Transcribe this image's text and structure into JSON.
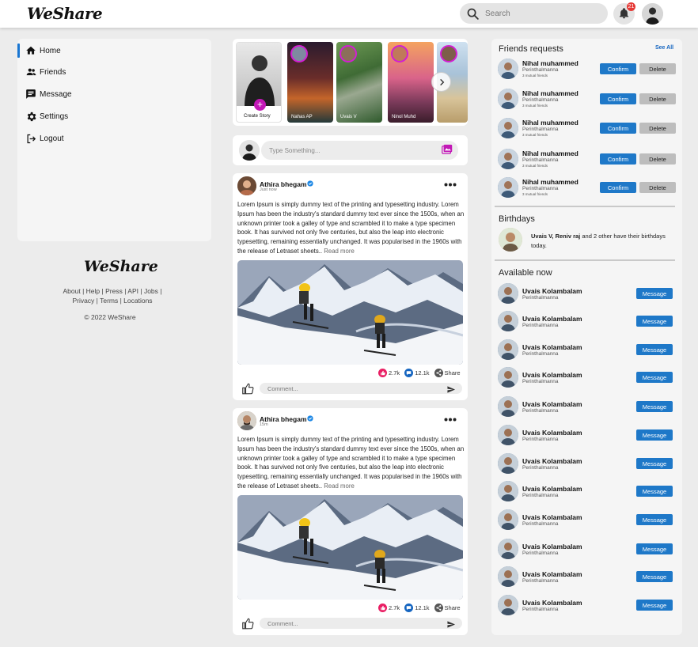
{
  "app": {
    "logo": "WeShare",
    "search_placeholder": "Search",
    "notification_count": "21"
  },
  "sidebar": {
    "items": [
      {
        "label": "Home",
        "icon": "home-icon",
        "active": true
      },
      {
        "label": "Friends",
        "icon": "people-icon",
        "active": false
      },
      {
        "label": "Message",
        "icon": "message-icon",
        "active": false
      },
      {
        "label": "Settings",
        "icon": "gear-icon",
        "active": false
      },
      {
        "label": "Logout",
        "icon": "logout-icon",
        "active": false
      }
    ]
  },
  "footer": {
    "logo": "WeShare",
    "links": [
      "About",
      "Help",
      "Press",
      "API",
      "Jobs",
      "Privacy",
      "Terms",
      "Locations"
    ],
    "copyright": "© 2022 WeShare"
  },
  "stories": {
    "create_label": "Create Story",
    "items": [
      {
        "name": "Nahas AP"
      },
      {
        "name": "Uvais V"
      },
      {
        "name": "Ninol Muhd"
      },
      {
        "name": ""
      }
    ]
  },
  "composer": {
    "placeholder": "Type Something..."
  },
  "posts": [
    {
      "author": "Athira bhegam",
      "time": "Just now",
      "text": "Lorem Ipsum is simply dummy text of the printing and typesetting industry. Lorem Ipsum has been the industry's standard dummy text ever since the 1500s, when an unknown printer took a galley of type and scrambled it to make a type specimen book. It has survived not only five centuries, but also the leap into electronic typesetting, remaining essentially unchanged. It was popularised in the 1960s with the release of Letraset sheets..",
      "read_more": "Read more",
      "likes": "2.7k",
      "comments": "12.1k",
      "share": "Share",
      "comment_placeholder": "Comment..."
    },
    {
      "author": "Athira bhegam",
      "time": "15m",
      "text": "Lorem Ipsum is simply dummy text of the printing and typesetting industry. Lorem Ipsum has been the industry's standard dummy text ever since the 1500s, when an unknown printer took a galley of type and scrambled it to make a type specimen book. It has survived not only five centuries, but also the leap into electronic typesetting, remaining essentially unchanged. It was popularised in the 1960s with the release of Letraset sheets..",
      "read_more": "Read more",
      "likes": "2.7k",
      "comments": "12.1k",
      "share": "Share",
      "comment_placeholder": "Comment..."
    }
  ],
  "friend_requests": {
    "title": "Friends requests",
    "see_all": "See All",
    "confirm_label": "Confirm",
    "delete_label": "Delete",
    "items": [
      {
        "name": "Nihal muhammed",
        "location": "Perinthalmanna",
        "mutual": "3 mutual friends"
      },
      {
        "name": "Nihal muhammed",
        "location": "Perinthalmanna",
        "mutual": "3 mutual friends"
      },
      {
        "name": "Nihal muhammed",
        "location": "Perinthalmanna",
        "mutual": "3 mutual friends"
      },
      {
        "name": "Nihal muhammed",
        "location": "Perinthalmanna",
        "mutual": "3 mutual friends"
      },
      {
        "name": "Nihal muhammed",
        "location": "Perinthalmanna",
        "mutual": "3 mutual friends"
      }
    ]
  },
  "birthdays": {
    "title": "Birthdays",
    "names": "Uvais V, Reniv raj",
    "rest": " and 2 other have their birthdays today."
  },
  "available": {
    "title": "Available now",
    "message_label": "Message",
    "items": [
      {
        "name": "Uvais Kolambalam",
        "location": "Perinthalmanna"
      },
      {
        "name": "Uvais Kolambalam",
        "location": "Perinthalmanna"
      },
      {
        "name": "Uvais Kolambalam",
        "location": "Perinthalmanna"
      },
      {
        "name": "Uvais Kolambalam",
        "location": "Perinthalmanna"
      },
      {
        "name": "Uvais Kolambalam",
        "location": "Perinthalmanna"
      },
      {
        "name": "Uvais Kolambalam",
        "location": "Perinthalmanna"
      },
      {
        "name": "Uvais Kolambalam",
        "location": "Perinthalmanna"
      },
      {
        "name": "Uvais Kolambalam",
        "location": "Perinthalmanna"
      },
      {
        "name": "Uvais Kolambalam",
        "location": "Perinthalmanna"
      },
      {
        "name": "Uvais Kolambalam",
        "location": "Perinthalmanna"
      },
      {
        "name": "Uvais Kolambalam",
        "location": "Perinthalmanna"
      },
      {
        "name": "Uvais Kolambalam",
        "location": "Perinthalmanna"
      }
    ]
  },
  "colors": {
    "accent": "#1e78c8",
    "story_ring": "#d21fd2",
    "notification": "#e53935",
    "like": "#e91e63"
  }
}
